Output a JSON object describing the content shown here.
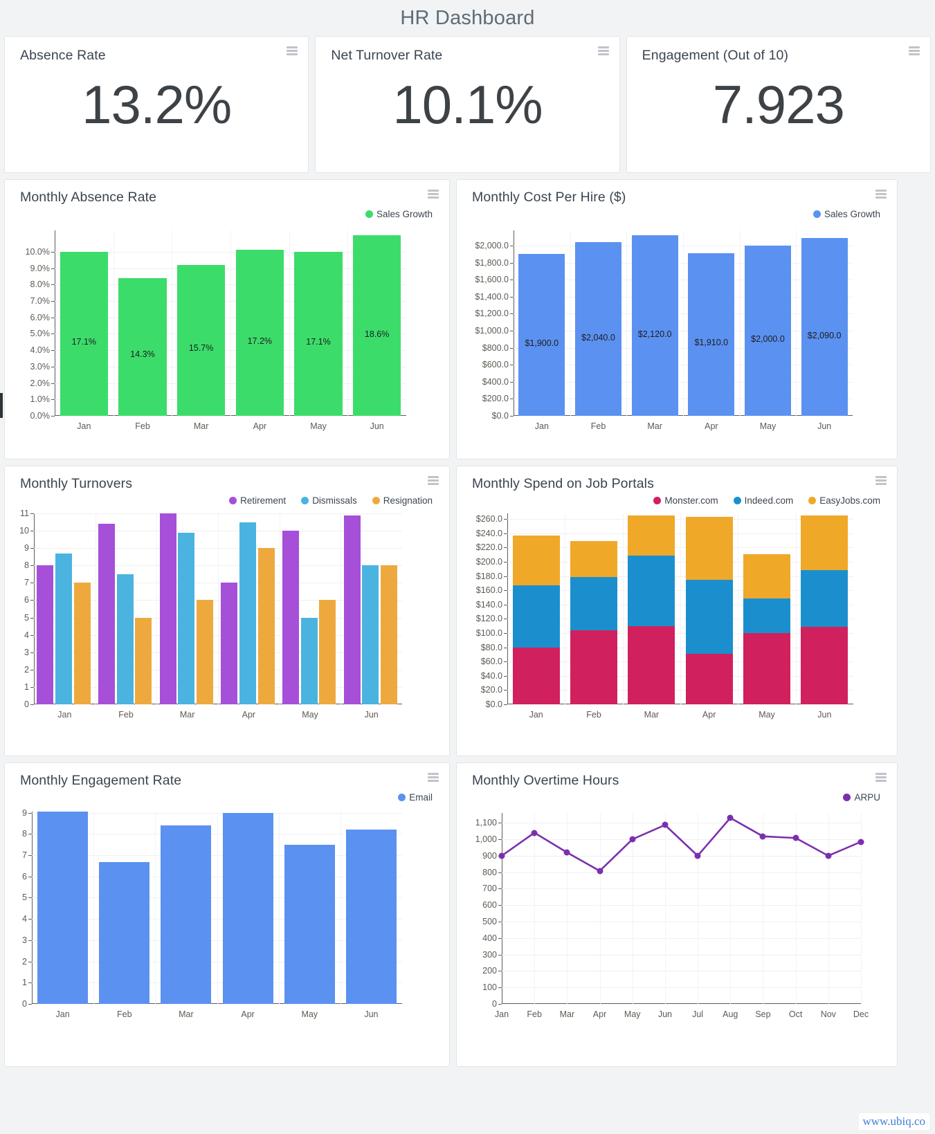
{
  "header": {
    "title": "HR Dashboard"
  },
  "kpis": [
    {
      "title": "Absence Rate",
      "value": "13.2%"
    },
    {
      "title": "Net Turnover Rate",
      "value": "10.1%"
    },
    {
      "title": "Engagement (Out of 10)",
      "value": "7.923"
    }
  ],
  "footer": {
    "url": "www.ubiq.co"
  },
  "icons": {
    "menu": "hamburger-menu-icon"
  },
  "colors": {
    "green": "#3cdc6b",
    "blue": "#5b91f0",
    "purple": "#a64fd8",
    "skyblue": "#4bb3e0",
    "orange": "#eea93e",
    "crimson": "#d1205e",
    "portal_blue": "#1b8fce",
    "portal_orange": "#f0a828",
    "line_purple": "#7b2fad",
    "title_gray": "#5f6c76"
  },
  "chart_data": [
    {
      "id": "monthly-absence-rate",
      "type": "bar",
      "title": "Monthly Absence Rate",
      "legend": [
        {
          "name": "Sales Growth",
          "color": "#3cdc6b"
        }
      ],
      "legend_position": "top-right",
      "categories": [
        "Jan",
        "Feb",
        "Mar",
        "Apr",
        "May",
        "Jun"
      ],
      "values": [
        10.0,
        8.4,
        9.2,
        10.1,
        10.0,
        11.0
      ],
      "data_labels": [
        "17.1%",
        "14.3%",
        "15.7%",
        "17.2%",
        "17.1%",
        "18.6%"
      ],
      "yticks": [
        "0.0%",
        "1.0%",
        "2.0%",
        "3.0%",
        "4.0%",
        "5.0%",
        "6.0%",
        "7.0%",
        "8.0%",
        "9.0%",
        "10.0%"
      ],
      "ylim": [
        0,
        11.3
      ],
      "ylabel": "",
      "xlabel": "",
      "grid": true
    },
    {
      "id": "monthly-cost-per-hire",
      "type": "bar",
      "title": "Monthly Cost Per Hire ($)",
      "legend": [
        {
          "name": "Sales Growth",
          "color": "#5b91f0"
        }
      ],
      "legend_position": "top-right",
      "categories": [
        "Jan",
        "Feb",
        "Mar",
        "Apr",
        "May",
        "Jun"
      ],
      "values": [
        1900,
        2040,
        2120,
        1910,
        2000,
        2090
      ],
      "data_labels": [
        "$1,900.0",
        "$2,040.0",
        "$2,120.0",
        "$1,910.0",
        "$2,000.0",
        "$2,090.0"
      ],
      "yticks": [
        "$0.0",
        "$200.0",
        "$400.0",
        "$600.0",
        "$800.0",
        "$1,000.0",
        "$1,200.0",
        "$1,400.0",
        "$1,600.0",
        "$1,800.0",
        "$2,000.0"
      ],
      "ylim": [
        0,
        2180
      ],
      "ylabel": "",
      "xlabel": "",
      "grid": true
    },
    {
      "id": "monthly-turnovers",
      "type": "bar",
      "title": "Monthly Turnovers",
      "legend": [
        {
          "name": "Retirement",
          "color": "#a64fd8"
        },
        {
          "name": "Dismissals",
          "color": "#4bb3e0"
        },
        {
          "name": "Resignation",
          "color": "#eea93e"
        }
      ],
      "legend_position": "top-right",
      "categories": [
        "Jan",
        "Feb",
        "Mar",
        "Apr",
        "May",
        "Jun"
      ],
      "series": [
        {
          "name": "Retirement",
          "color": "#a64fd8",
          "values": [
            8.0,
            10.4,
            11.0,
            7.0,
            10.0,
            10.9
          ]
        },
        {
          "name": "Dismissals",
          "color": "#4bb3e0",
          "values": [
            8.7,
            7.5,
            9.9,
            10.5,
            5.0,
            8.0
          ]
        },
        {
          "name": "Resignation",
          "color": "#eea93e",
          "values": [
            7.0,
            5.0,
            6.0,
            9.0,
            6.0,
            8.0
          ]
        }
      ],
      "yticks": [
        "0",
        "1",
        "2",
        "3",
        "4",
        "5",
        "6",
        "7",
        "8",
        "9",
        "10",
        "11"
      ],
      "ylim": [
        0,
        11
      ],
      "ylabel": "",
      "xlabel": "",
      "grid": true
    },
    {
      "id": "monthly-spend-job-portals",
      "type": "bar",
      "stacked": true,
      "title": "Monthly Spend on Job Portals",
      "legend": [
        {
          "name": "Monster.com",
          "color": "#d1205e"
        },
        {
          "name": "Indeed.com",
          "color": "#1b8fce"
        },
        {
          "name": "EasyJobs.com",
          "color": "#f0a828"
        }
      ],
      "legend_position": "top-right",
      "categories": [
        "Jan",
        "Feb",
        "Mar",
        "Apr",
        "May",
        "Jun"
      ],
      "series": [
        {
          "name": "Monster.com",
          "color": "#d1205e",
          "values": [
            80,
            104,
            110,
            71,
            100,
            109
          ]
        },
        {
          "name": "Indeed.com",
          "color": "#1b8fce",
          "values": [
            87,
            75,
            99,
            104,
            49,
            79
          ]
        },
        {
          "name": "EasyJobs.com",
          "color": "#f0a828",
          "values": [
            70,
            50,
            56,
            88,
            62,
            77
          ]
        }
      ],
      "totals": [
        237,
        229,
        265,
        263,
        211,
        265
      ],
      "yticks": [
        "$0.0",
        "$20.0",
        "$40.0",
        "$60.0",
        "$80.0",
        "$100.0",
        "$120.0",
        "$140.0",
        "$160.0",
        "$180.0",
        "$200.0",
        "$220.0",
        "$240.0",
        "$260.0"
      ],
      "ylim": [
        0,
        268
      ],
      "ylabel": "",
      "xlabel": "",
      "grid": true
    },
    {
      "id": "monthly-engagement-rate",
      "type": "bar",
      "title": "Monthly Engagement Rate",
      "legend": [
        {
          "name": "Email",
          "color": "#5b91f0"
        }
      ],
      "legend_position": "top-right",
      "categories": [
        "Jan",
        "Feb",
        "Mar",
        "Apr",
        "May",
        "Jun"
      ],
      "values": [
        9.05,
        6.67,
        8.4,
        8.97,
        7.48,
        8.2
      ],
      "yticks": [
        "0",
        "1",
        "2",
        "3",
        "4",
        "5",
        "6",
        "7",
        "8",
        "9"
      ],
      "ylim": [
        0,
        9.05
      ],
      "ylabel": "",
      "xlabel": "",
      "grid": true
    },
    {
      "id": "monthly-overtime-hours",
      "type": "line",
      "title": "Monthly Overtime Hours",
      "legend": [
        {
          "name": "ARPU",
          "color": "#7b2fad"
        }
      ],
      "legend_position": "top-right",
      "categories": [
        "Jan",
        "Feb",
        "Mar",
        "Apr",
        "May",
        "Jun",
        "Jul",
        "Aug",
        "Sep",
        "Oct",
        "Nov",
        "Dec"
      ],
      "values": [
        900,
        1040,
        920,
        808,
        1000,
        1087,
        900,
        1130,
        1018,
        1008,
        900,
        985
      ],
      "yticks": [
        "0",
        "100",
        "200",
        "300",
        "400",
        "500",
        "600",
        "700",
        "800",
        "900",
        "1,000",
        "1,100"
      ],
      "ylim": [
        0,
        1160
      ],
      "ylabel": "",
      "xlabel": "",
      "grid": true
    }
  ]
}
